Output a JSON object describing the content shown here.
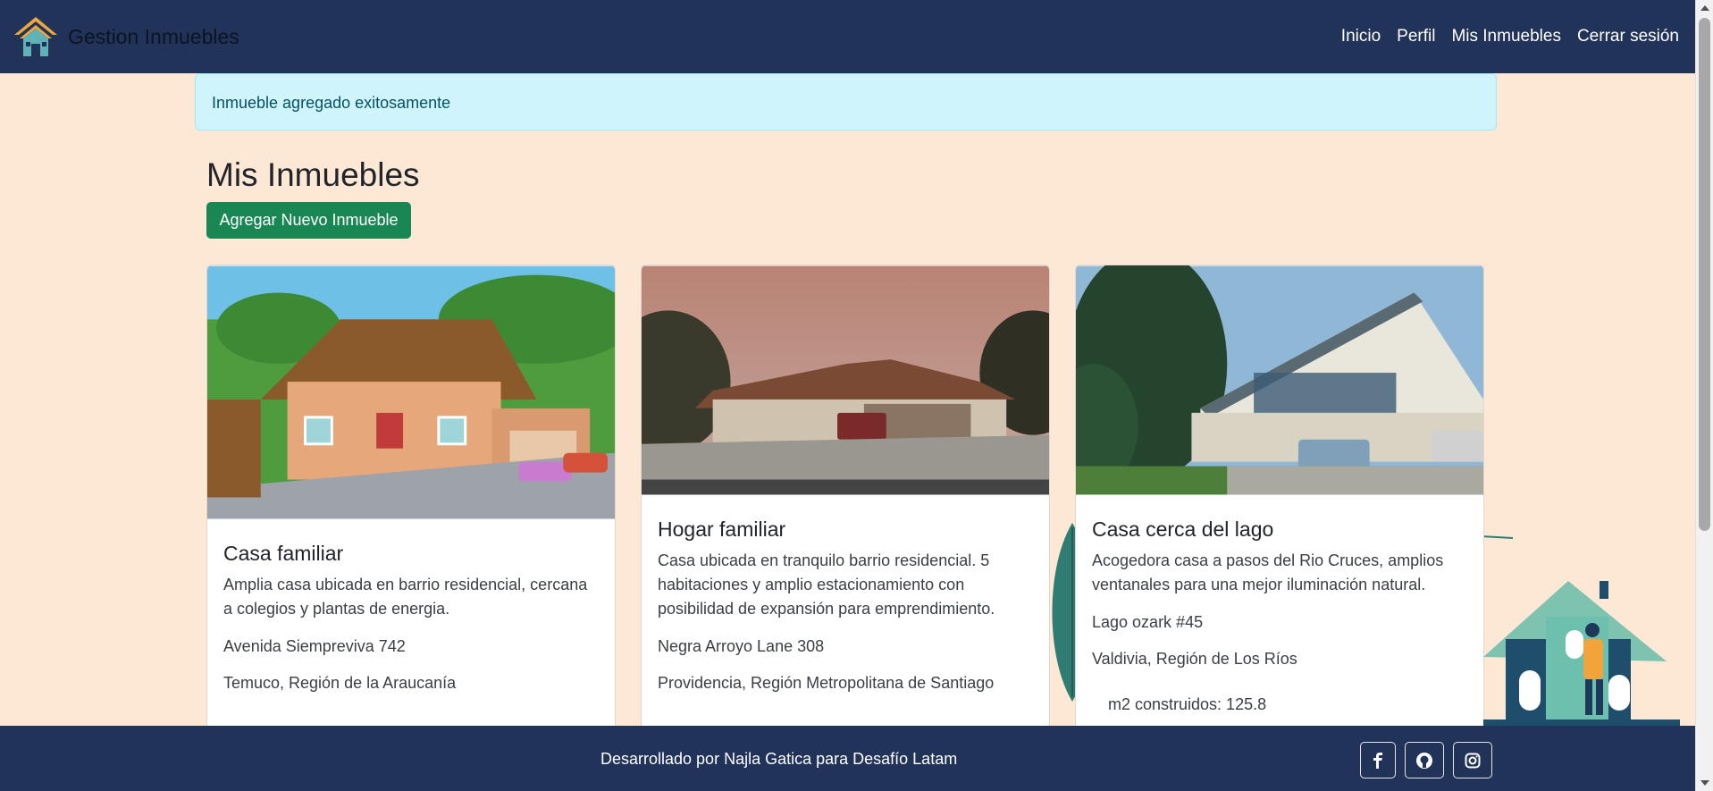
{
  "navbar": {
    "brand": "Gestion Inmuebles",
    "links": [
      "Inicio",
      "Perfil",
      "Mis Inmuebles",
      "Cerrar sesión"
    ]
  },
  "alert": {
    "text": "Inmueble agregado exitosamente"
  },
  "main": {
    "title": "Mis Inmuebles",
    "add_button": "Agregar Nuevo Inmueble"
  },
  "cards": [
    {
      "title": "Casa familiar",
      "description": "Amplia casa ubicada en barrio residencial, cercana a colegios y plantas de energia.",
      "address": "Avenida Siempreviva 742",
      "location": "Temuco, Región de la Araucanía",
      "image": "cartoon-house-image"
    },
    {
      "title": "Hogar familiar",
      "description": "Casa ubicada en tranquilo barrio residencial. 5 habitaciones y amplio estacionamiento con posibilidad de expansión para emprendimiento.",
      "address": "Negra Arroyo Lane 308",
      "location": "Providencia, Región Metropolitana de Santiago",
      "image": "suburban-house-image"
    },
    {
      "title": "Casa cerca del lago",
      "description": "Acogedora casa a pasos del Rio Cruces, amplios ventanales para una mejor iluminación natural.",
      "address": "Lago ozark #45",
      "location": "Valdivia, Región de Los Ríos",
      "m2": "m2 construidos: 125.8",
      "image": "lake-house-image"
    }
  ],
  "footer": {
    "text": "Desarrollado por Najla Gatica para Desafío Latam",
    "icons": [
      "facebook-icon",
      "github-icon",
      "instagram-icon"
    ]
  },
  "colors": {
    "navbar": "#213358",
    "background": "#fde8d5",
    "alert_bg": "#cff4fc",
    "success": "#198754"
  }
}
